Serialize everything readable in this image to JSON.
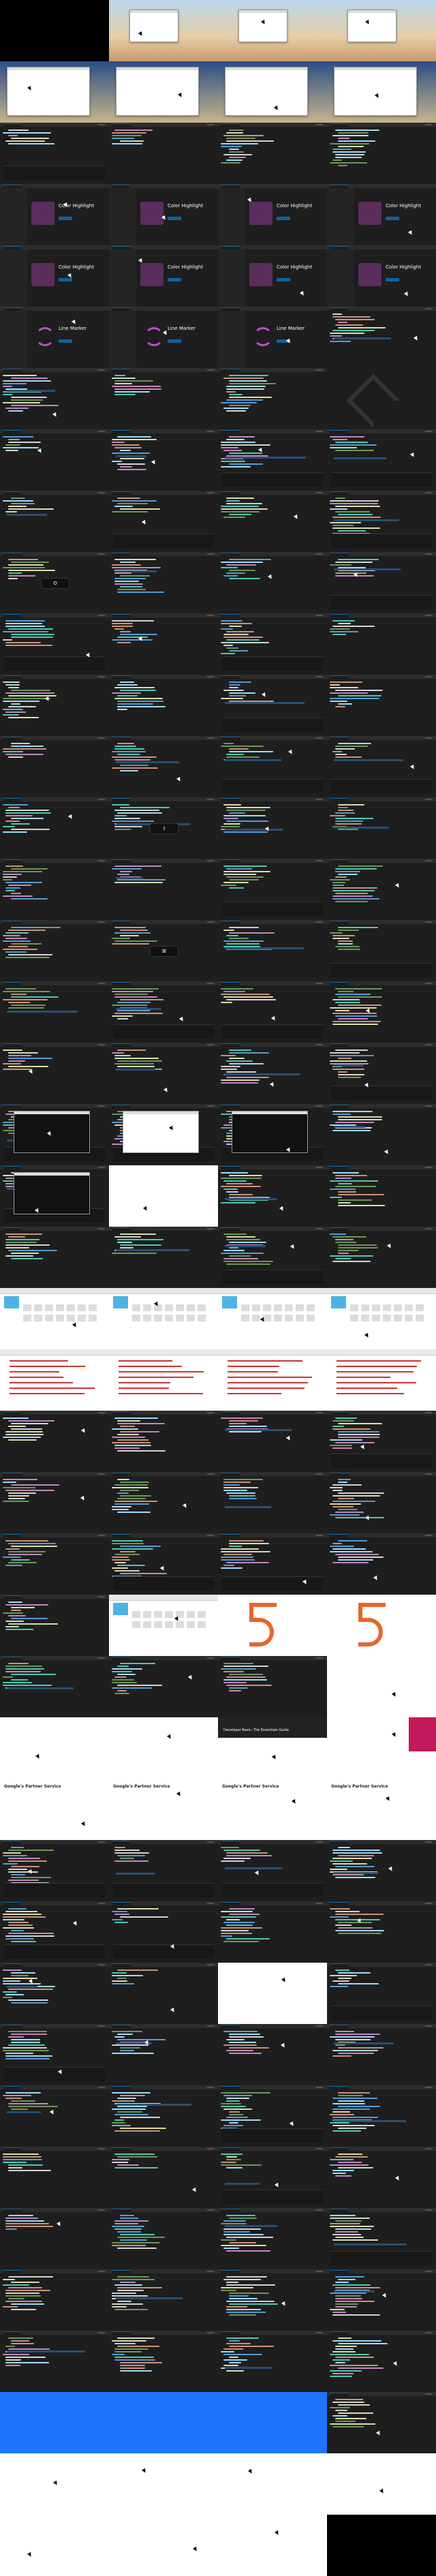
{
  "frames": {
    "ext_color_highlight": "Color Highlight",
    "ext_line_marker": "Line Marker",
    "key_up": "⇧",
    "key_cmd": "⌘",
    "key_o": "O",
    "site_title": "Google's Partner Service",
    "dark_site_title": "Developer Basic: The Essentials Guide"
  },
  "colors": {
    "editor_bg": "#1e1e1e",
    "accent": "#0e639c",
    "blue_frame": "#1e73ff",
    "orange": "#e8652a"
  }
}
